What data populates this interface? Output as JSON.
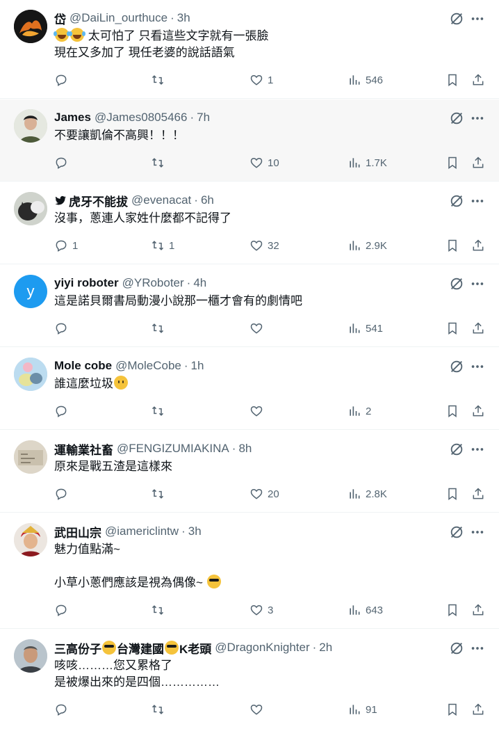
{
  "tweets": [
    {
      "name": "岱",
      "handle": "@DaiLin_ourthuce",
      "time": "3h",
      "lines": [
        "太可怕了 只看這些文字就有一張臉",
        "現在又多加了 現任老婆的說話語氣"
      ],
      "lead_emoji": "face-with-tears-of-joy x2",
      "reply": "",
      "retweet": "",
      "like": "1",
      "views": "546"
    },
    {
      "name": "James",
      "handle": "@James0805466",
      "time": "7h",
      "lines": [
        "不要讓凱倫不高興！！！"
      ],
      "reply": "",
      "retweet": "",
      "like": "10",
      "views": "1.7K"
    },
    {
      "name": "虎牙不能拔",
      "handle": "@evenacat",
      "time": "6h",
      "lines": [
        "沒事，蔥連人家姓什麼都不記得了"
      ],
      "reply": "1",
      "retweet": "1",
      "like": "32",
      "views": "2.9K"
    },
    {
      "name": "yiyi roboter",
      "handle": "@YRoboter",
      "time": "4h",
      "avatar_letter": "y",
      "lines": [
        "這是諾貝爾書局動漫小說那一櫃才會有的劇情吧"
      ],
      "reply": "",
      "retweet": "",
      "like": "",
      "views": "541"
    },
    {
      "name": "Mole cobe",
      "handle": "@MoleCobe",
      "time": "1h",
      "lines": [
        "誰這麼垃圾"
      ],
      "reply": "",
      "retweet": "",
      "like": "",
      "views": "2"
    },
    {
      "name": "運輸業社畜",
      "handle": "@FENGIZUMIAKINA",
      "time": "8h",
      "lines": [
        "原來是戰五渣是這樣來"
      ],
      "reply": "",
      "retweet": "",
      "like": "20",
      "views": "2.8K"
    },
    {
      "name": "武田山宗",
      "handle": "@iamericlintw",
      "time": "3h",
      "lines": [
        "魅力值點滿~",
        "",
        "小草小蔥們應該是視為偶像~"
      ],
      "reply": "",
      "retweet": "",
      "like": "3",
      "views": "643"
    },
    {
      "name_parts": [
        "三高份子",
        "台灣建國",
        "K老頭"
      ],
      "handle": "@DragonKnighter",
      "time": "2h",
      "lines": [
        "咳咳………您又累格了",
        "是被爆出來的是四個……………"
      ],
      "reply": "",
      "retweet": "",
      "like": "",
      "views": "91"
    }
  ],
  "icons": {
    "reply": "reply-icon",
    "retweet": "retweet-icon",
    "like": "like-icon",
    "views": "views-icon",
    "bookmark": "bookmark-icon",
    "share": "share-icon",
    "grok": "grok-icon",
    "more": "more-icon"
  },
  "colors": {
    "text": "#0f1419",
    "muted": "#536471",
    "divider": "#eff3f4",
    "highlight_bg": "#f7f7f7",
    "avatar_blue": "#1d9bf0"
  }
}
